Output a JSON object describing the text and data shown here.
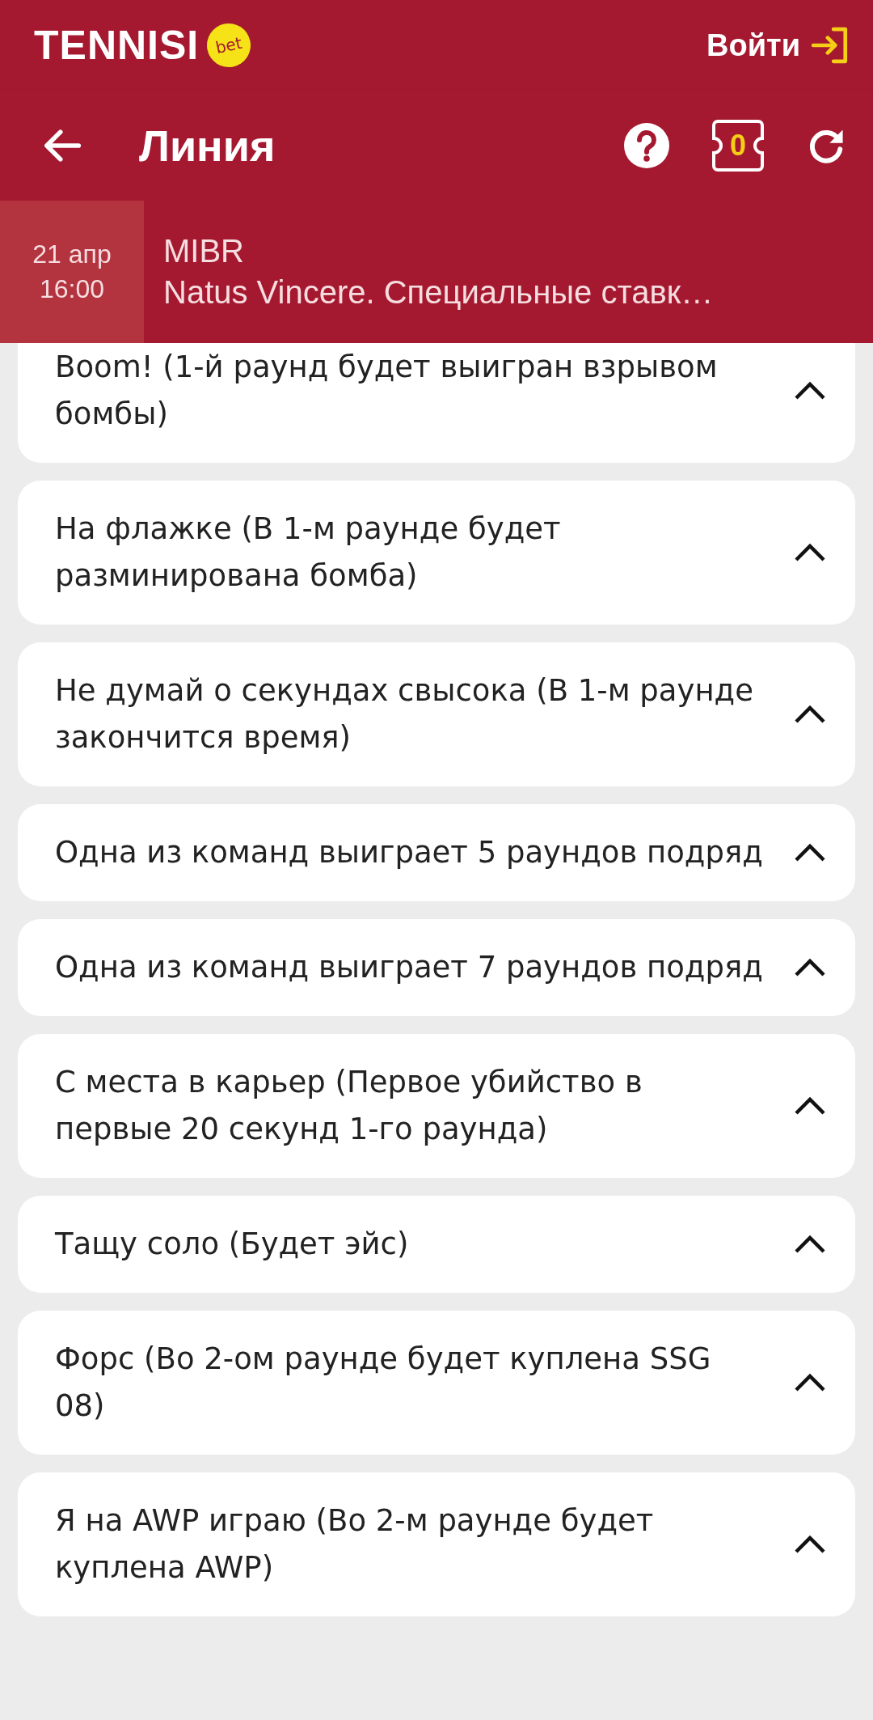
{
  "top_bar": {
    "logo": "TENNISI",
    "logo_badge": "bet",
    "login": "Войти"
  },
  "nav_bar": {
    "title": "Линия",
    "coupon_count": "0"
  },
  "event": {
    "date": "21 апр",
    "time": "16:00",
    "team_1": "MIBR",
    "team_2": "Natus Vincere. Специальные ставк…"
  },
  "markets": [
    {
      "label": "Boom! (1-й раунд будет выигран взрывом бомбы)",
      "expanded": true
    },
    {
      "label": "На флажке (В 1-м раунде будет разминирована бомба)",
      "expanded": true
    },
    {
      "label": "Не думай о секундах свысока (В 1-м раунде закончится время)",
      "expanded": true
    },
    {
      "label": "Одна из команд выиграет 5 раундов подряд",
      "expanded": true
    },
    {
      "label": "Одна из команд выиграет 7 раундов подряд",
      "expanded": true
    },
    {
      "label": "С места в карьер (Первое убийство в первые 20 секунд 1-го раунда)",
      "expanded": true
    },
    {
      "label": "Тащу соло (Будет эйс)",
      "expanded": true
    },
    {
      "label": "Форс (Во 2-ом раунде будет куплена SSG 08)",
      "expanded": true
    },
    {
      "label": "Я на AWP играю (Во 2-м раунде будет куплена AWP)",
      "expanded": true
    }
  ]
}
